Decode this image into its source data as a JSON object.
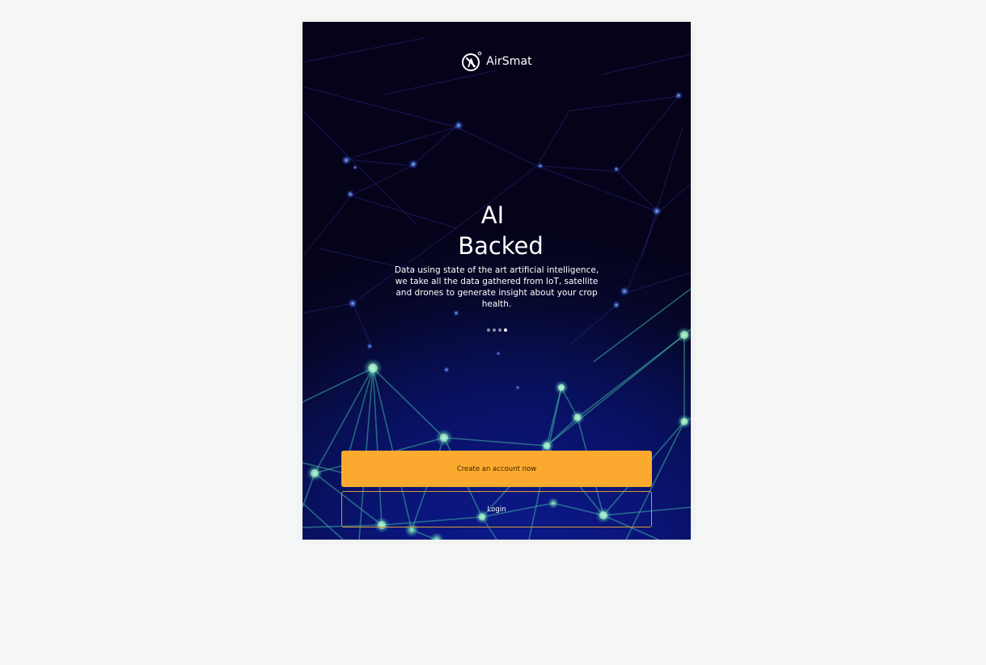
{
  "app": {
    "brand_name": "AirSmat",
    "brand_icon": "airsmat-logo-icon"
  },
  "onboarding": {
    "headline_line1": "AI",
    "headline_line2": "Backed",
    "description": "Data using state of the art artificial intelligence, we take all the data gathered from IoT, satellite and drones to generate insight about your crop health.",
    "slides_total": 4,
    "active_slide": 4
  },
  "actions": {
    "create_account_label": "Create an account now",
    "login_label": "Login"
  },
  "colors": {
    "accent": "#fcaa2f",
    "background_dark": "#05031a",
    "background_blue": "#0d1a8c",
    "network_lines": "#3fb2a3"
  }
}
